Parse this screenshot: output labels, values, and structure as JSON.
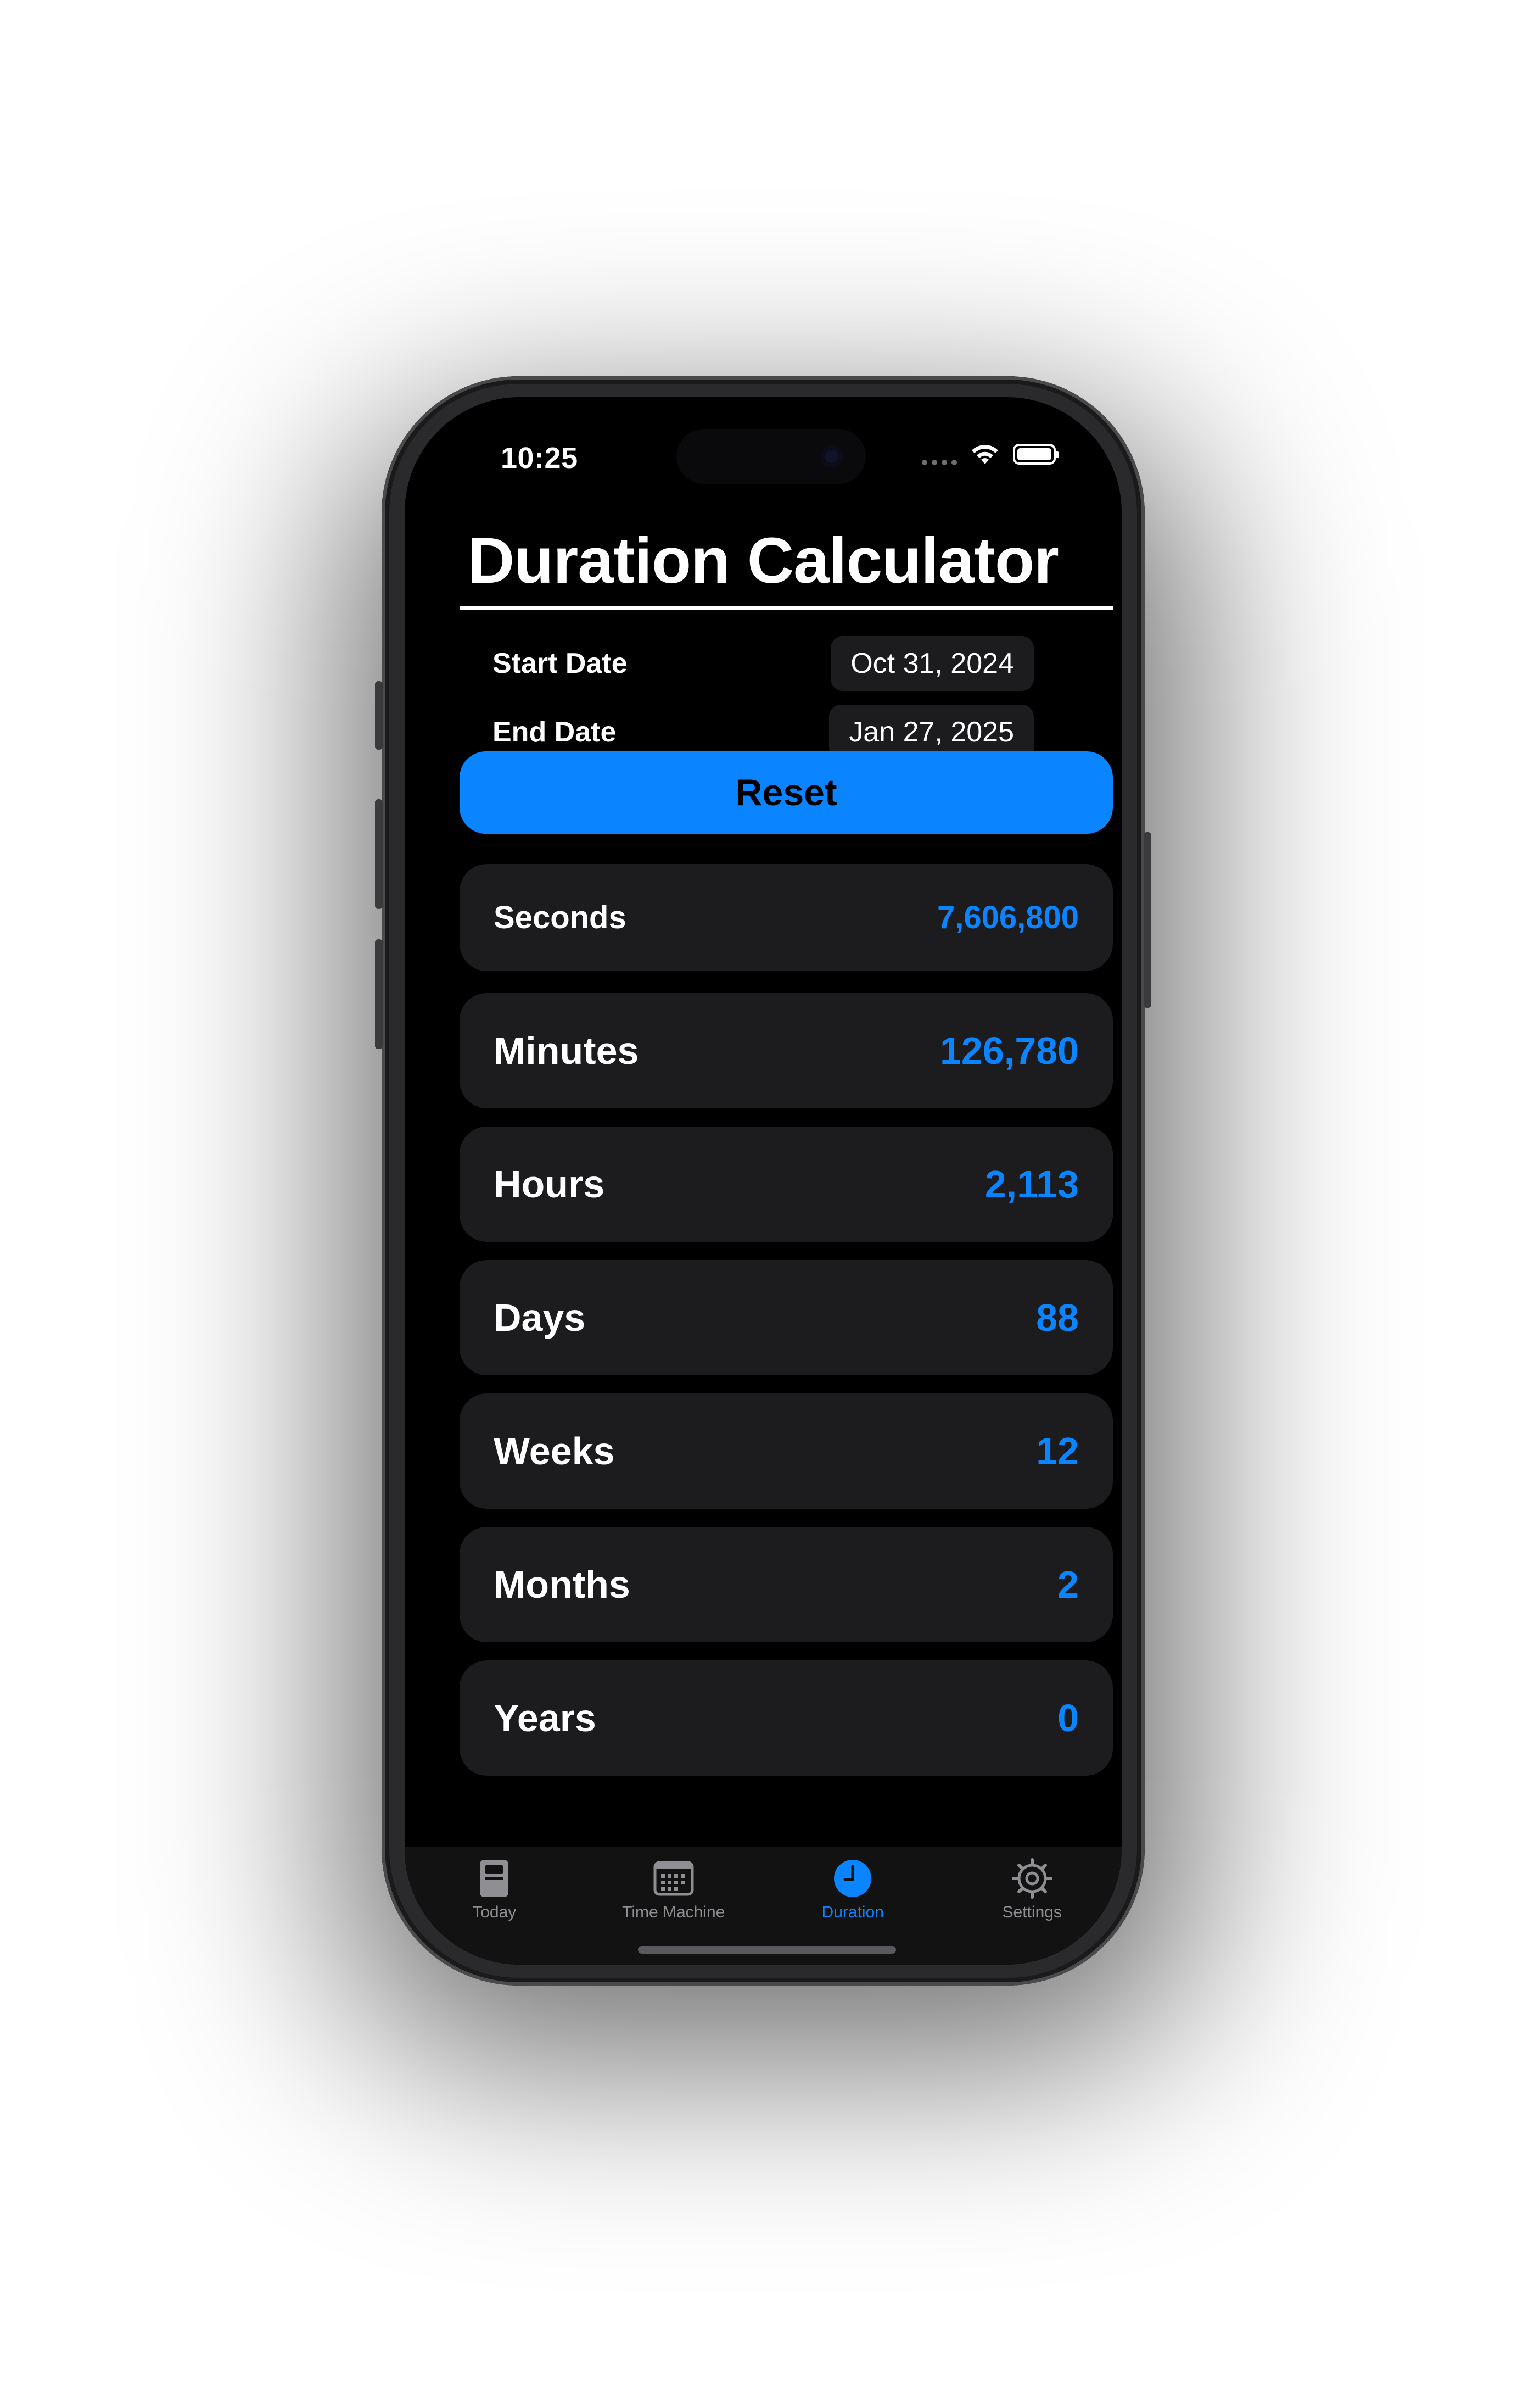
{
  "status_bar": {
    "time": "10:25",
    "signal_icon": "signal-dots-icon",
    "wifi_icon": "wifi-icon",
    "battery_icon": "battery-icon"
  },
  "header": {
    "title": "Duration Calculator"
  },
  "dates": {
    "start_label": "Start Date",
    "start_value": "Oct 31, 2024",
    "end_label": "End Date",
    "end_value": "Jan 27, 2025"
  },
  "reset_button": {
    "label": "Reset"
  },
  "results": [
    {
      "label": "Seconds",
      "value": "7,606,800"
    },
    {
      "label": "Minutes",
      "value": "126,780"
    },
    {
      "label": "Hours",
      "value": "2,113"
    },
    {
      "label": "Days",
      "value": "88"
    },
    {
      "label": "Weeks",
      "value": "12"
    },
    {
      "label": "Months",
      "value": "2"
    },
    {
      "label": "Years",
      "value": "0"
    }
  ],
  "tab_bar": {
    "tabs": [
      {
        "label": "Today",
        "icon": "book-icon",
        "active": false
      },
      {
        "label": "Time Machine",
        "icon": "calendar-icon",
        "active": false
      },
      {
        "label": "Duration",
        "icon": "clock-icon",
        "active": true
      },
      {
        "label": "Settings",
        "icon": "gear-icon",
        "active": false
      }
    ]
  },
  "colors": {
    "accent": "#0a84ff",
    "background": "#000000",
    "card": "#1c1c1e"
  }
}
